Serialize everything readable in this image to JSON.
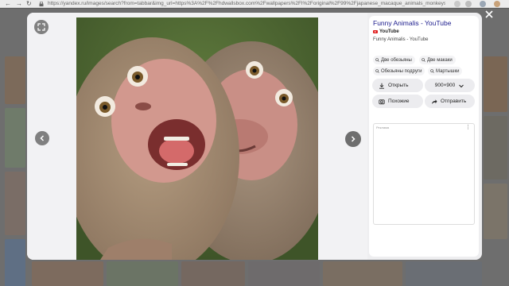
{
  "browser": {
    "url": "https://yandex.ru/images/search?from=tabbar&img_url=https%3A%2F%2Fhdwallsbox.com%2Fwallpapers%2Fl%2Foriginal%2F99%2Fjapanese_macaque_animals_monkeys_1920x1200_9..."
  },
  "viewer": {
    "title": "Funny Animalis - YouTube",
    "source_name": "YouTube",
    "source_subtitle": "Funny Animalis - YouTube",
    "tags": [
      "Две обезьяны",
      "Две макаки",
      "Обезьяны подруги",
      "Мартышки"
    ],
    "open_label": "Открыть",
    "size_label": "900×900",
    "similar_label": "Похожие",
    "share_label": "Отправить",
    "ad_label": "Реклама"
  },
  "colors": {
    "accent_title": "#1a1a8c",
    "youtube_red": "#e02020",
    "overlay_bg": "#eeeef0"
  }
}
